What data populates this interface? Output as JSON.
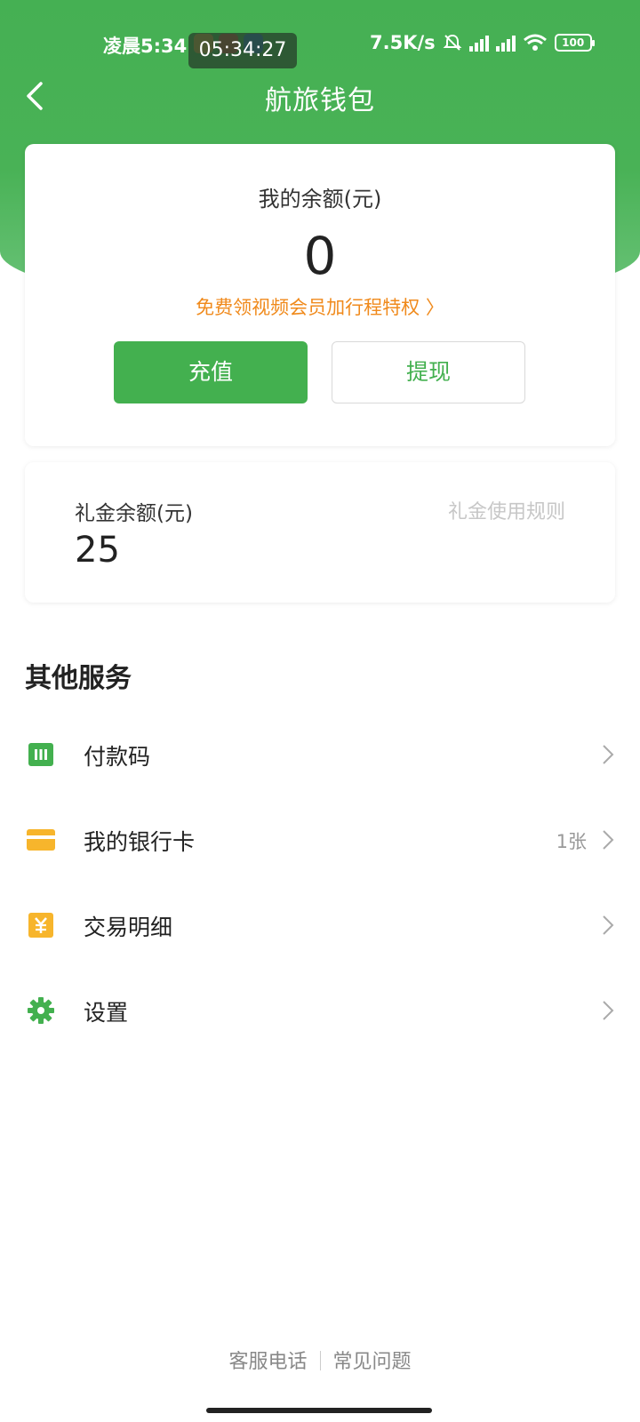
{
  "status_bar": {
    "time": "凌晨5:34",
    "clock_overlay": "05:34:27",
    "network_speed": "7.5K/s",
    "battery": "100",
    "icons": [
      "mute-bell-icon",
      "hd-signal-icon",
      "hd-signal-icon",
      "wifi-icon",
      "battery-icon"
    ]
  },
  "nav": {
    "title": "航旅钱包",
    "back_icon": "chevron-left-icon"
  },
  "balance": {
    "label": "我的余额(元)",
    "amount": "0",
    "promo": "免费领视频会员加行程特权 〉",
    "recharge_label": "充值",
    "withdraw_label": "提现"
  },
  "gift": {
    "label": "礼金余额(元)",
    "amount": "25",
    "rules_link": "礼金使用规则"
  },
  "services": {
    "title": "其他服务",
    "items": [
      {
        "label": "付款码",
        "icon": "payment-code-icon",
        "extra": "",
        "color": "#43b04f"
      },
      {
        "label": "我的银行卡",
        "icon": "bank-card-icon",
        "extra": "1张",
        "color": "#f7b52c"
      },
      {
        "label": "交易明细",
        "icon": "yuan-receipt-icon",
        "extra": "",
        "color": "#f7b52c"
      },
      {
        "label": "设置",
        "icon": "gear-icon",
        "extra": "",
        "color": "#43b04f"
      }
    ]
  },
  "footer": {
    "service_phone": "客服电话",
    "faq": "常见问题"
  },
  "colors": {
    "brand_green": "#43b04f",
    "promo_orange": "#f08a1c",
    "card_yellow": "#f7b52c"
  }
}
